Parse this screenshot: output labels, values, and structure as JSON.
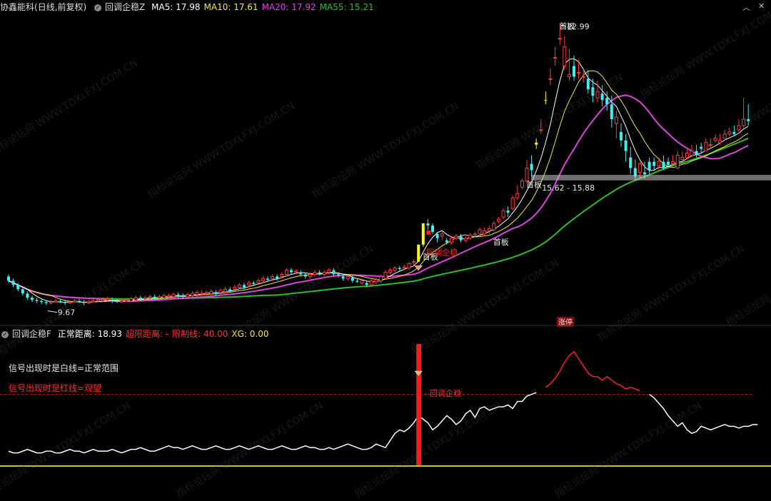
{
  "header": {
    "stock": "协鑫能科",
    "period": "(日线,前复权)",
    "indicator": "回调企稳Z",
    "ma": [
      {
        "label": "MA5: 17.98",
        "color": "#ffffff"
      },
      {
        "label": "MA10: 17.61",
        "color": "#f5e642"
      },
      {
        "label": "MA20: 17.92",
        "color": "#e040e0"
      },
      {
        "label": "MA55: 15.21",
        "color": "#27c027"
      }
    ]
  },
  "sub_header": {
    "indicator": "回调企稳F",
    "items": [
      {
        "label": "正常距离: 18.93",
        "color": "#ffffff"
      },
      {
        "label": "超限距离: -",
        "color": "#ff3030"
      },
      {
        "label": "限制线: 40.00",
        "color": "#ff3030"
      },
      {
        "label": "XG: 0.00",
        "color": "#f5e642"
      }
    ]
  },
  "notes": {
    "white_line": "信号出现时是白线=正常范围",
    "red_line": "信号出现时是红线=观望"
  },
  "watermark": "指标论坛网 WWW.TDXLFXJ.COM.CN",
  "controls": {
    "up": "︿",
    "close": "✕"
  },
  "colors": {
    "up": "#ff3b3b",
    "down": "#3ff0f0",
    "limit_up": "#ffff00",
    "ma5": "#ffffff",
    "ma10": "#f5e642",
    "ma20": "#e040e0",
    "ma55": "#27c027"
  },
  "chart_data": [
    {
      "type": "candlestick",
      "title": "",
      "ylim": [
        9.0,
        23.5
      ],
      "annotations": {
        "high_label": "22.99",
        "low_label": "9.67",
        "price_band": "15.62 - 15.88",
        "first_board": "首板",
        "signal": "回调企稳",
        "limit_tag": "涨停"
      },
      "x": [
        0,
        1,
        2,
        3,
        4,
        5,
        6,
        7,
        8,
        9,
        10,
        11,
        12,
        13,
        14,
        15,
        16,
        17,
        18,
        19,
        20,
        21,
        22,
        23,
        24,
        25,
        26,
        27,
        28,
        29,
        30,
        31,
        32,
        33,
        34,
        35,
        36,
        37,
        38,
        39,
        40,
        41,
        42,
        43,
        44,
        45,
        46,
        47,
        48,
        49,
        50,
        51,
        52,
        53,
        54,
        55,
        56,
        57,
        58,
        59,
        60,
        61,
        62,
        63,
        64,
        65,
        66,
        67,
        68,
        69,
        70,
        71,
        72,
        73,
        74,
        75,
        76,
        77,
        78,
        79,
        80,
        81,
        82,
        83,
        84,
        85,
        86,
        87,
        88,
        89,
        90,
        91,
        92,
        93,
        94,
        95,
        96,
        97,
        98,
        99,
        100,
        101,
        102,
        103,
        104,
        105,
        106,
        107,
        108,
        109,
        110,
        111,
        112,
        113,
        114,
        115,
        116,
        117,
        118,
        119,
        120,
        121,
        122,
        123,
        124,
        125,
        126,
        127,
        128,
        129,
        130,
        131,
        132,
        133,
        134,
        135,
        136,
        137,
        138,
        139,
        140,
        141,
        142,
        143,
        144,
        145,
        146,
        147,
        148,
        149,
        150,
        151,
        152,
        153,
        154,
        155,
        156,
        157
      ],
      "open": [
        11.1,
        10.9,
        10.7,
        10.5,
        10.3,
        10.1,
        10.0,
        9.95,
        9.9,
        9.85,
        9.9,
        9.95,
        9.9,
        9.85,
        9.9,
        9.95,
        9.9,
        9.85,
        9.9,
        9.95,
        9.95,
        10.0,
        10.0,
        9.95,
        9.9,
        9.95,
        9.95,
        10.0,
        10.1,
        10.05,
        10.1,
        10.15,
        10.1,
        10.1,
        10.15,
        10.15,
        10.25,
        10.2,
        10.15,
        10.2,
        10.25,
        10.3,
        10.3,
        10.3,
        10.35,
        10.35,
        10.4,
        10.5,
        10.5,
        10.6,
        10.7,
        10.7,
        10.8,
        10.8,
        10.9,
        11.0,
        11.0,
        11.1,
        11.1,
        11.2,
        11.4,
        11.3,
        11.3,
        11.2,
        11.1,
        11.2,
        11.3,
        11.2,
        11.3,
        11.4,
        11.2,
        11.1,
        11.0,
        11.05,
        10.9,
        10.8,
        10.8,
        10.7,
        10.85,
        10.9,
        11.0,
        11.3,
        11.4,
        11.5,
        11.5,
        11.5,
        11.75,
        11.8,
        12.6,
        13.6,
        13.5,
        13.1,
        13.0,
        12.8,
        12.7,
        12.9,
        13.0,
        12.8,
        12.9,
        13.05,
        13.1,
        13.1,
        13.25,
        13.3,
        13.7,
        13.9,
        14.2,
        14.3,
        14.8,
        15.3,
        15.6,
        16.4,
        17.3,
        18.0,
        19.4,
        20.4,
        21.4,
        22.3,
        21.0,
        20.5,
        21.0,
        20.7,
        20.5,
        20.4,
        20.0,
        19.5,
        19.7,
        19.5,
        19.2,
        18.3,
        17.9,
        17.5,
        16.7,
        16.2,
        16.0,
        16.0,
        16.5,
        16.5,
        16.3,
        16.5,
        16.5,
        16.4,
        16.2,
        16.6,
        16.7,
        16.8,
        17.0,
        17.2,
        17.0,
        17.3,
        17.5,
        17.4,
        17.6,
        17.8,
        17.9,
        18.0,
        18.2,
        18.5
      ],
      "close": [
        10.9,
        10.7,
        10.5,
        10.3,
        10.1,
        10.0,
        9.95,
        9.9,
        9.85,
        9.9,
        9.95,
        9.9,
        9.85,
        9.9,
        9.95,
        9.9,
        9.85,
        9.9,
        9.95,
        10.0,
        10.0,
        10.05,
        9.95,
        9.9,
        9.95,
        10.0,
        10.05,
        10.1,
        10.05,
        10.1,
        10.15,
        10.1,
        10.15,
        10.2,
        10.2,
        10.25,
        10.2,
        10.15,
        10.25,
        10.3,
        10.35,
        10.3,
        10.35,
        10.4,
        10.3,
        10.45,
        10.5,
        10.4,
        10.6,
        10.7,
        10.6,
        10.8,
        10.75,
        10.9,
        11.0,
        10.95,
        11.1,
        11.0,
        11.2,
        11.4,
        11.3,
        11.35,
        11.2,
        11.1,
        11.2,
        11.3,
        11.25,
        11.3,
        11.4,
        11.2,
        11.15,
        11.0,
        11.1,
        10.9,
        10.85,
        10.9,
        10.7,
        10.9,
        10.95,
        11.1,
        11.3,
        11.4,
        11.5,
        11.45,
        11.55,
        11.7,
        11.8,
        12.6,
        13.6,
        13.5,
        13.2,
        12.9,
        13.1,
        12.7,
        12.9,
        13.0,
        12.8,
        12.9,
        13.05,
        13.1,
        13.3,
        13.25,
        13.35,
        13.6,
        13.8,
        14.2,
        14.1,
        14.8,
        15.0,
        15.6,
        16.2,
        16.1,
        17.4,
        18.0,
        19.4,
        20.4,
        21.4,
        22.3,
        21.9,
        20.6,
        20.5,
        20.7,
        20.5,
        19.9,
        19.6,
        19.8,
        19.4,
        19.2,
        18.5,
        18.6,
        17.5,
        17.0,
        16.2,
        15.8,
        16.4,
        15.9,
        16.1,
        16.3,
        16.5,
        16.2,
        16.35,
        16.5,
        16.8,
        16.7,
        16.9,
        17.0,
        16.8,
        17.1,
        17.4,
        17.3,
        17.6,
        17.5,
        17.8,
        17.9,
        17.8,
        18.2,
        18.5,
        18.4
      ],
      "high": [
        11.2,
        11.0,
        10.8,
        10.6,
        10.4,
        10.2,
        10.1,
        10.05,
        10.0,
        10.0,
        10.05,
        10.05,
        10.0,
        10.0,
        10.05,
        10.05,
        10.0,
        10.0,
        10.05,
        10.1,
        10.1,
        10.15,
        10.1,
        10.05,
        10.05,
        10.1,
        10.15,
        10.2,
        10.2,
        10.2,
        10.25,
        10.25,
        10.25,
        10.3,
        10.3,
        10.35,
        10.35,
        10.3,
        10.35,
        10.4,
        10.45,
        10.45,
        10.45,
        10.5,
        10.45,
        10.55,
        10.6,
        10.6,
        10.7,
        10.8,
        10.8,
        10.9,
        10.9,
        11.0,
        11.1,
        11.1,
        11.2,
        11.2,
        11.3,
        11.5,
        11.5,
        11.45,
        11.4,
        11.3,
        11.3,
        11.4,
        11.4,
        11.4,
        11.5,
        11.5,
        11.3,
        11.2,
        11.2,
        11.15,
        11.0,
        11.0,
        10.9,
        11.0,
        11.05,
        11.2,
        11.4,
        11.5,
        11.6,
        11.6,
        11.65,
        11.8,
        11.9,
        12.6,
        13.6,
        13.8,
        13.6,
        13.2,
        13.2,
        12.9,
        13.0,
        13.1,
        13.1,
        13.0,
        13.15,
        13.2,
        13.4,
        13.4,
        13.5,
        13.7,
        13.9,
        14.3,
        14.4,
        14.9,
        15.4,
        15.7,
        16.6,
        16.8,
        17.6,
        18.5,
        19.8,
        20.9,
        21.9,
        22.99,
        22.4,
        21.8,
        21.5,
        21.3,
        20.9,
        20.8,
        20.4,
        20.3,
        20.1,
        19.8,
        19.6,
        18.9,
        18.3,
        17.8,
        17.2,
        16.6,
        16.5,
        16.5,
        16.7,
        16.7,
        16.7,
        16.8,
        16.7,
        16.8,
        17.0,
        17.0,
        17.1,
        17.3,
        17.3,
        17.4,
        17.6,
        17.6,
        17.8,
        17.8,
        18.0,
        18.1,
        18.2,
        18.5,
        19.5,
        19.2
      ],
      "low": [
        10.8,
        10.6,
        10.4,
        10.2,
        10.0,
        9.9,
        9.85,
        9.8,
        9.75,
        9.8,
        9.85,
        9.85,
        9.75,
        9.8,
        9.85,
        9.85,
        9.75,
        9.8,
        9.85,
        9.9,
        9.9,
        9.95,
        9.85,
        9.85,
        9.85,
        9.9,
        9.9,
        9.95,
        9.95,
        10.0,
        10.0,
        10.0,
        10.0,
        10.05,
        10.05,
        10.1,
        10.1,
        10.05,
        10.1,
        10.1,
        10.15,
        10.2,
        10.2,
        10.25,
        10.2,
        10.25,
        10.3,
        10.35,
        10.4,
        10.5,
        10.5,
        10.6,
        10.65,
        10.7,
        10.8,
        10.85,
        10.9,
        10.9,
        11.0,
        11.1,
        11.2,
        11.2,
        11.1,
        11.0,
        11.0,
        11.1,
        11.15,
        11.1,
        11.2,
        11.1,
        11.05,
        10.9,
        10.9,
        10.8,
        10.8,
        10.7,
        10.6,
        10.6,
        10.75,
        10.8,
        10.95,
        11.2,
        11.3,
        11.35,
        11.4,
        11.4,
        11.6,
        11.8,
        12.5,
        13.3,
        13.1,
        12.7,
        12.8,
        12.6,
        12.6,
        12.8,
        12.7,
        12.7,
        12.8,
        12.95,
        13.0,
        13.0,
        13.1,
        13.2,
        13.6,
        13.8,
        13.9,
        14.2,
        14.7,
        15.2,
        15.5,
        15.8,
        17.1,
        17.8,
        19.2,
        20.1,
        21.0,
        22.0,
        20.8,
        20.3,
        20.3,
        20.4,
        20.2,
        19.7,
        19.3,
        19.3,
        19.1,
        18.9,
        18.1,
        17.6,
        17.2,
        16.5,
        15.9,
        15.62,
        15.7,
        15.7,
        15.9,
        16.1,
        16.1,
        16.1,
        16.2,
        16.3,
        16.5,
        16.5,
        16.6,
        16.7,
        16.7,
        16.9,
        17.2,
        17.1,
        17.4,
        17.3,
        17.6,
        17.7,
        17.7,
        17.9,
        18.1,
        18.2
      ]
    },
    {
      "type": "line",
      "title": "",
      "ylim": [
        0,
        70
      ],
      "threshold": 40,
      "signal_index": 87,
      "normal": [
        8,
        7,
        7,
        8,
        9,
        8,
        7,
        7,
        8,
        8,
        7,
        7,
        8,
        9,
        8,
        8,
        7,
        8,
        9,
        8,
        8,
        8,
        9,
        8,
        7,
        8,
        9,
        9,
        10,
        9,
        8,
        8,
        9,
        10,
        11,
        10,
        10,
        9,
        10,
        11,
        10,
        9,
        9,
        10,
        11,
        10,
        9,
        9,
        10,
        11,
        10,
        9,
        10,
        11,
        10,
        9,
        9,
        10,
        11,
        10,
        9,
        9,
        10,
        11,
        10,
        10,
        9,
        9,
        10,
        9,
        10,
        11,
        12,
        11,
        10,
        9,
        9,
        10,
        12,
        11,
        10,
        14,
        18,
        20,
        19,
        21,
        24,
        28,
        26,
        24,
        20,
        22,
        25,
        28,
        26,
        23,
        25,
        29,
        31,
        27,
        32,
        33,
        31,
        32,
        33,
        33,
        34,
        32,
        36,
        36,
        39,
        40,
        41,
        null,
        null,
        null,
        null,
        null,
        null,
        null,
        null,
        null,
        null,
        null,
        null,
        null,
        null,
        null,
        null,
        null,
        null,
        null,
        null,
        null,
        null,
        null,
        40,
        38,
        35,
        32,
        28,
        25,
        22,
        24,
        20,
        18,
        19,
        22,
        21,
        20,
        21,
        22,
        23,
        22,
        22,
        21,
        22,
        22,
        23,
        23
      ],
      "limit": [
        null,
        null,
        null,
        null,
        null,
        null,
        null,
        null,
        null,
        null,
        null,
        null,
        null,
        null,
        null,
        null,
        null,
        null,
        null,
        null,
        null,
        null,
        null,
        null,
        null,
        null,
        null,
        null,
        null,
        null,
        null,
        null,
        null,
        null,
        null,
        null,
        null,
        null,
        null,
        null,
        null,
        null,
        null,
        null,
        null,
        null,
        null,
        null,
        null,
        null,
        null,
        null,
        null,
        null,
        null,
        null,
        null,
        null,
        null,
        null,
        null,
        null,
        null,
        null,
        null,
        null,
        null,
        null,
        null,
        null,
        null,
        null,
        null,
        null,
        null,
        null,
        null,
        null,
        null,
        null,
        null,
        null,
        null,
        null,
        null,
        null,
        null,
        null,
        null,
        null,
        null,
        null,
        null,
        null,
        null,
        null,
        null,
        null,
        null,
        null,
        null,
        null,
        null,
        null,
        null,
        null,
        null,
        null,
        null,
        null,
        null,
        null,
        null,
        null,
        44,
        46,
        49,
        53,
        58,
        62,
        64,
        60,
        56,
        52,
        50,
        50,
        48,
        50,
        48,
        46,
        45,
        43,
        44,
        43,
        42,
        null,
        null,
        null,
        null,
        null,
        null,
        null,
        null,
        null,
        null,
        null,
        null,
        null,
        null,
        null,
        null,
        null,
        null,
        null,
        null,
        null,
        null,
        null
      ]
    }
  ]
}
